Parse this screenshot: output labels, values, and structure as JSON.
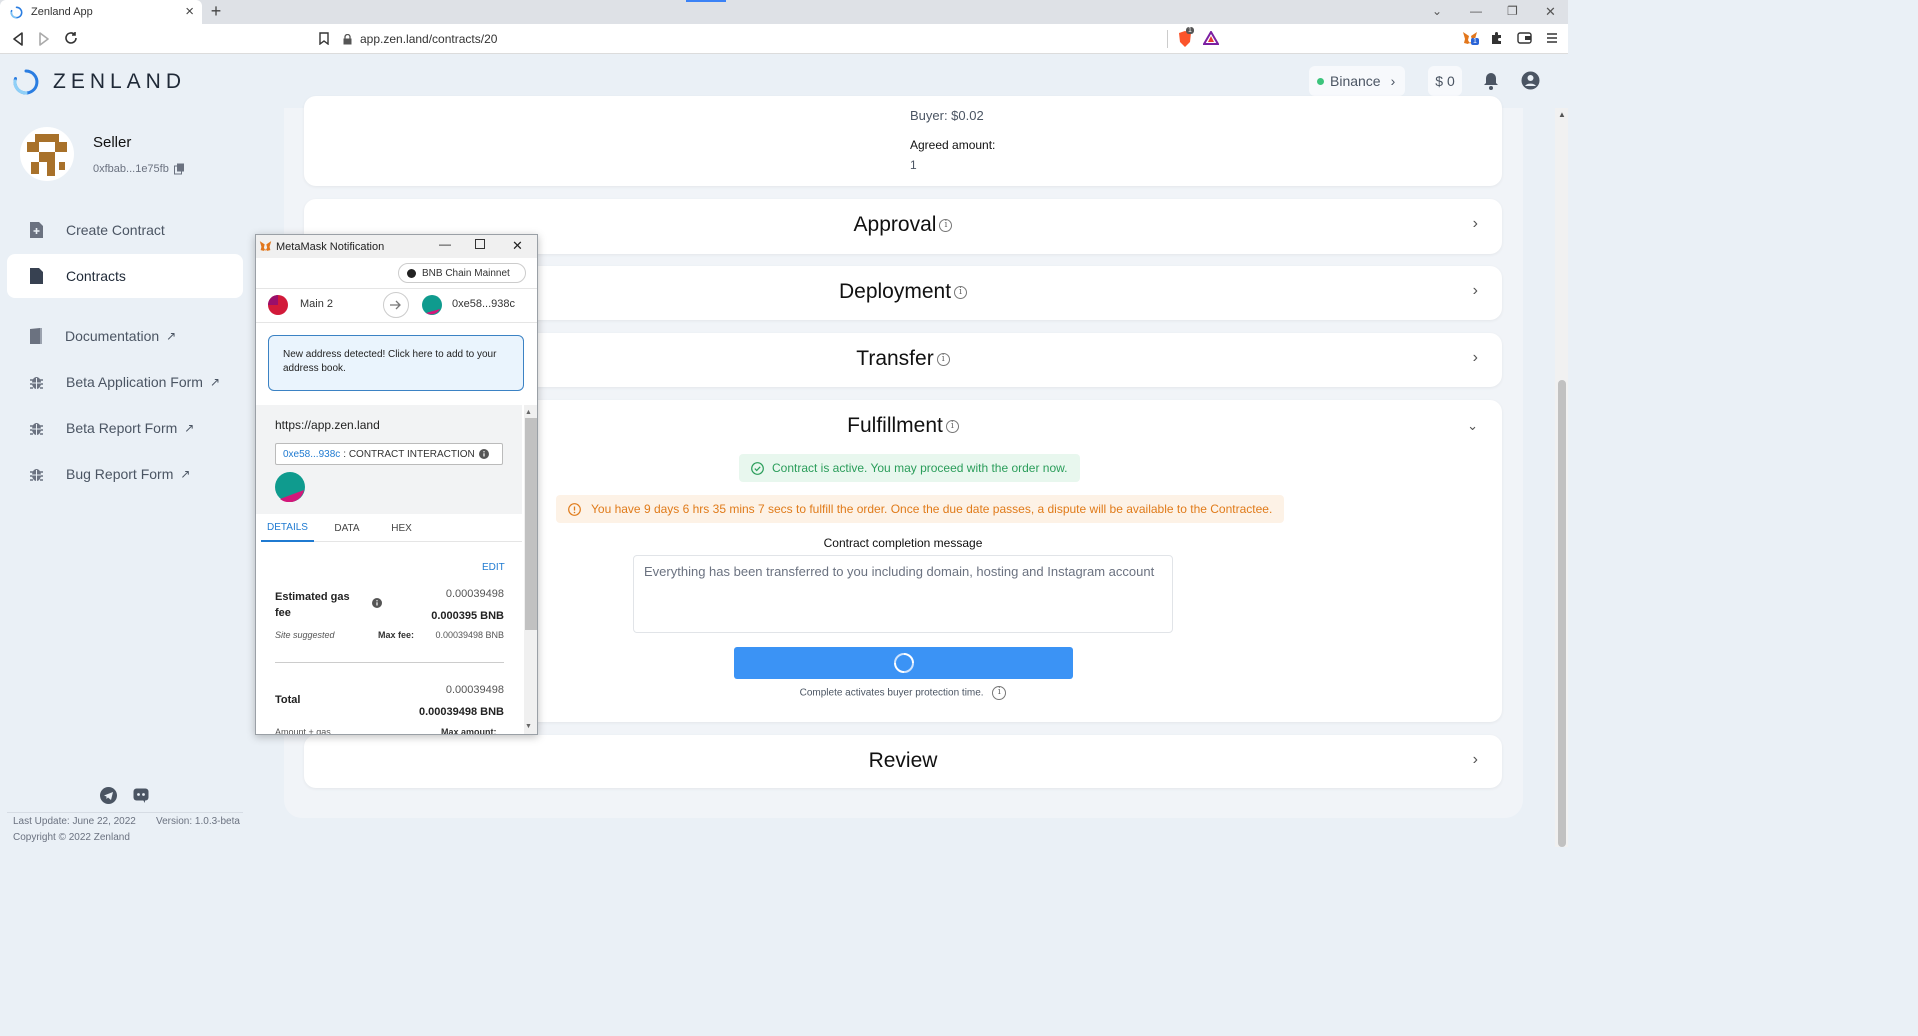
{
  "browser": {
    "tab_title": "Zenland App",
    "tab_close": "×",
    "new_tab": "+",
    "url": "app.zen.land/contracts/20",
    "brave_badge": "1",
    "metamask_badge": "1"
  },
  "header": {
    "brand": "ZENLAND",
    "network": "Binance",
    "balance": "$ 0"
  },
  "profile": {
    "role": "Seller",
    "address": "0xfbab...1e75fb"
  },
  "sidebar": {
    "items": [
      {
        "label": "Create Contract",
        "external": false
      },
      {
        "label": "Contracts",
        "external": false
      },
      {
        "label": "Documentation",
        "external": true
      },
      {
        "label": "Beta Application Form",
        "external": true
      },
      {
        "label": "Beta Report Form",
        "external": true
      },
      {
        "label": "Bug Report Form",
        "external": true
      }
    ],
    "ext_arrow": "↗",
    "last_update": "Last Update: June 22, 2022",
    "version": "Version: 1.0.3-beta",
    "copyright": "Copyright © 2022 Zenland"
  },
  "contract": {
    "buyer_fee": "Buyer: $0.02",
    "agreed_amount_label": "Agreed amount:",
    "agreed_amount_value": "1",
    "sections": {
      "approval": "Approval",
      "deployment": "Deployment",
      "transfer": "Transfer",
      "fulfillment": "Fulfillment",
      "review": "Review"
    },
    "active_message": "Contract is active. You may proceed with the order now.",
    "warning_message": "You have 9 days 6 hrs 35 mins 7 secs to fulfill the order. Once the due date passes, a dispute will be available to the Contractee.",
    "completion_label": "Contract completion message",
    "completion_text": "Everything has been transferred to you including domain, hosting and Instagram account",
    "protection_note": "Complete activates buyer protection time."
  },
  "metamask": {
    "window_title": "MetaMask Notification",
    "network": "BNB Chain Mainnet",
    "from_account": "Main 2",
    "to_account": "0xe58...938c",
    "notice": "New address detected! Click here to add to your address book.",
    "origin": "https://app.zen.land",
    "contract_address": "0xe58...938c",
    "interaction_label": ": CONTRACT INTERACTION",
    "tabs": [
      "DETAILS",
      "DATA",
      "HEX"
    ],
    "edit_label": "EDIT",
    "gas_label": "Estimated gas fee",
    "gas_value": "0.00039498",
    "gas_bnb": "0.000395 BNB",
    "site_suggested": "Site suggested",
    "max_fee_label": "Max fee:",
    "max_fee_value": "0.00039498 BNB",
    "total_label": "Total",
    "total_value": "0.00039498",
    "total_bnb": "0.00039498 BNB",
    "amount_gas": "Amount + gas",
    "max_amount": "Max amount:"
  },
  "colors": {
    "accent": "#3b93f5",
    "success_bg": "#e8f7ee",
    "success_text": "#2a9d5a",
    "warning_bg": "#fdf2e6",
    "warning_text": "#e07b1a"
  }
}
